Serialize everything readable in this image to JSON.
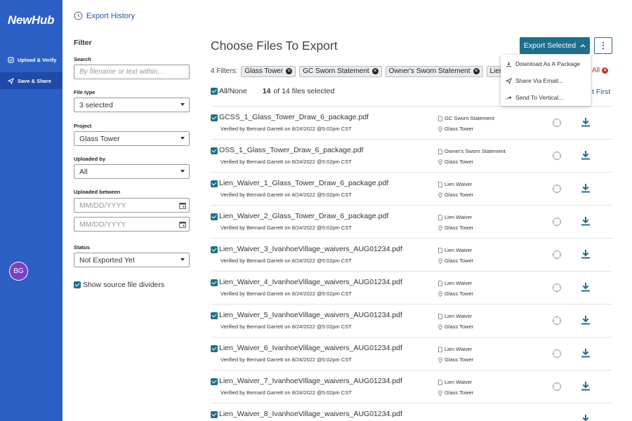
{
  "app": {
    "brand": "NewHub"
  },
  "sidebar": {
    "items": [
      {
        "label": "Upload & Verify",
        "icon": "upload-verify-icon"
      },
      {
        "label": "Save & Share",
        "icon": "send-icon",
        "active": true
      }
    ],
    "avatar": "BG"
  },
  "filters_panel": {
    "export_history": "Export History",
    "title": "Filter",
    "search": {
      "label": "Search",
      "placeholder": "By filename or text within..."
    },
    "file_type": {
      "label": "File type",
      "value": "3 selected"
    },
    "project": {
      "label": "Project",
      "value": "Glass Tower"
    },
    "uploaded_by": {
      "label": "Uploaded by",
      "value": "All"
    },
    "uploaded_between": {
      "label": "Uploaded between",
      "from_placeholder": "MM/DD/YYYY",
      "to_placeholder": "MM/DD/YYYY"
    },
    "status": {
      "label": "Status",
      "value": "Not Exported Yet"
    },
    "show_dividers": "Show source file dividers"
  },
  "main": {
    "title": "Choose Files To Export",
    "export_button": "Export Selected",
    "filters_label": "4 Filters:",
    "chips": [
      "Glass Tower",
      "GC Sworn Statement",
      "Owner's Sworn Statement",
      "Lien"
    ],
    "clear_all": "All",
    "all_none": "All/None",
    "selected_count": "14",
    "selected_suffix": "of 14 files selected",
    "sort_link": "t First",
    "dropdown": [
      {
        "label": "Download As A Package",
        "icon": "download-icon"
      },
      {
        "label": "Share Via Email...",
        "icon": "send-icon"
      },
      {
        "label": "Send To Vertical...",
        "icon": "share-arrow-icon"
      }
    ],
    "files": [
      {
        "name": "GCSS_1_Glass_Tower_Draw_6_package.pdf",
        "verified": "Verified by Bernard Garrett on 8/24/2022 @5:02pm CST",
        "type": "GC Sworn Statement",
        "project": "Glass Tower"
      },
      {
        "name": "OSS_1_Glass_Tower_Draw_6_package.pdf",
        "verified": "Verified by Bernard Garrett on 8/24/2022 @5:02pm CST",
        "type": "Owner's Sworn Statement",
        "project": "Glass Tower"
      },
      {
        "name": "Lien_Waiver_1_Glass_Tower_Draw_6_package.pdf",
        "verified": "Verified by Bernard Garrett on 8/24/2022 @5:02pm CST",
        "type": "Lien Waiver",
        "project": "Glass Tower"
      },
      {
        "name": "Lien_Waiver_2_Glass_Tower_Draw_6_package.pdf",
        "verified": "Verified by Bernard Garrett on 8/24/2022 @5:02pm CST",
        "type": "Lien Waiver",
        "project": "Glass Tower"
      },
      {
        "name": "Lien_Waiver_3_IvanhoeVillage_waivers_AUG01234.pdf",
        "verified": "Verified by Bernard Garrett on 8/24/2022 @5:02pm CST",
        "type": "Lien Waiver",
        "project": "Glass Tower"
      },
      {
        "name": "Lien_Waiver_4_IvanhoeVillage_waivers_AUG01234.pdf",
        "verified": "Verified by Bernard Garrett on 8/24/2022 @5:02pm CST",
        "type": "Lien Waiver",
        "project": "Glass Tower"
      },
      {
        "name": "Lien_Waiver_5_IvanhoeVillage_waivers_AUG01234.pdf",
        "verified": "Verified by Bernard Garrett on 8/24/2022 @5:02pm CST",
        "type": "Lien Waiver",
        "project": "Glass Tower"
      },
      {
        "name": "Lien_Waiver_6_IvanhoeVillage_waivers_AUG01234.pdf",
        "verified": "Verified by Bernard Garrett on 8/24/2022 @5:02pm CST",
        "type": "Lien Waiver",
        "project": "Glass Tower"
      },
      {
        "name": "Lien_Waiver_7_IvanhoeVillage_waivers_AUG01234.pdf",
        "verified": "Verified by Bernard Garrett on 8/24/2022 @5:02pm CST",
        "type": "Lien Waiver",
        "project": "Glass Tower"
      },
      {
        "name": "Lien_Waiver_8_IvanhoeVillage_waivers_AUG01234.pdf",
        "verified": "",
        "type": "",
        "project": ""
      }
    ]
  },
  "colors": {
    "sidebar": "#2c5fc4",
    "accent": "#1f6f8b",
    "link": "#1f5aa0",
    "danger": "#c0392b",
    "avatar": "#7b3fc9"
  }
}
